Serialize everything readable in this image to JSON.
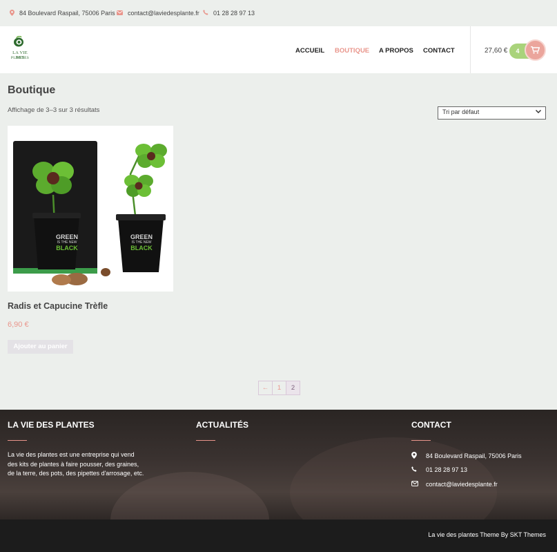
{
  "topbar": {
    "address": "84 Boulevard Raspail, 75006 Paris",
    "email": "contact@laviedesplante.fr",
    "phone": "01 28 28 97 13"
  },
  "logo": {
    "line1": "LA VIE DES",
    "line2": "PLANTES"
  },
  "nav": {
    "items": [
      "ACCUEIL",
      "BOUTIQUE",
      "A PROPOS",
      "CONTACT"
    ],
    "active": "BOUTIQUE"
  },
  "cart": {
    "total": "27,60 €",
    "count": "4"
  },
  "main": {
    "title": "Boutique",
    "result_count": "Affichage de 3–3 sur 3 résultats",
    "orderby": "Tri par défaut"
  },
  "product": {
    "name": "Radis et Capucine Trèfle",
    "price": "6,90 €",
    "button": "Ajouter au panier",
    "pot_text": [
      "GREEN",
      "IS THE NEW",
      "BLACK"
    ]
  },
  "pagination": {
    "prev": "←",
    "pages": [
      "1",
      "2"
    ],
    "current": "2"
  },
  "footer": {
    "about_title": "LA VIE DES PLANTES",
    "about_text": "La vie des plantes est une entreprise qui vend des kits de plantes à faire pousser, des graines, de la terre, des pots, des pipettes d'arrosage, etc.",
    "news_title": "ACTUALITÉS",
    "contact_title": "CONTACT",
    "address": "84 Boulevard Raspail, 75006 Paris",
    "phone": "01 28 28 97 13",
    "email": "contact@laviedesplante.fr",
    "credit": "La vie des plantes Theme By SKT Themes"
  },
  "colors": {
    "accent": "#e9958b",
    "cart_green": "#a9d37b",
    "bg": "#ecefec",
    "footer_dark": "#1c1c1c"
  }
}
